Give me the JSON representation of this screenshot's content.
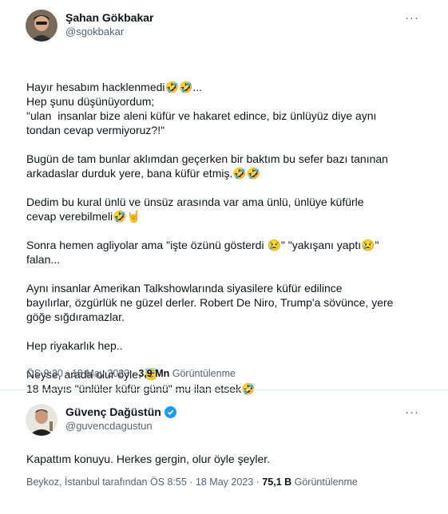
{
  "tweet1": {
    "name": "Şahan Gökbakar",
    "handle": "@sgokbakar",
    "more": "···",
    "lines": [
      "Hayır hesabım hacklenmedi🤣🤣...",
      "Hep şunu düşünüyordum;",
      "\"ulan  insanlar bize aleni küfür ve hakaret edince, biz ünlüyüz diye aynı",
      "tondan cevap vermiyoruz?!\"",
      "",
      "Bugün de tam bunlar aklımdan geçerken bir baktım bu sefer bazı tanınan",
      "arkadaslar durduk yere, bana küfür etmiş.🤣🤣",
      "",
      "Dedim bu kural ünlü ve ünsüz arasında var ama ünlü, ünlüye küfürle",
      "cevap verebilmeli🤣🤘",
      "",
      "Sonra hemen agliyolar ama \"işte özünü gösterdi 😢\" \"yakışanı yaptı😢\"",
      "falan...",
      "",
      "Aynı insanlar Amerikan Talkshowlarında siyasilere küfür edilince",
      "bayılırlar, özgürlük ne güzel derler. Robert De Niro, Trump'a sövünce, yere",
      "göğe sığdıramazlar.",
      "",
      "Hep riyakarlık hep..",
      "",
      "Neyse, arada olur öyle. 😇",
      "18 Mayıs \"ünlüler küfür günü\" mu ilan etsek🤣"
    ],
    "meta_time": "ÖS 9:30 · 18 May 2023 · ",
    "views": "3,9 Mn",
    "views_label": " Görüntülenme"
  },
  "tweet2": {
    "name": "Güvenç Dağüstün",
    "handle": "@guvencdagustun",
    "more": "···",
    "text": "Kapattım konuyu. Herkes gergin, olur öyle şeyler.",
    "meta_time": "Beykoz, İstanbul tarafından ÖS 8:55 · 18 May 2023 · ",
    "views": "75,1 B",
    "views_label": " Görüntülenme"
  },
  "colors": {
    "text": "#0f1419",
    "muted": "#536471",
    "verified": "#1d9bf0"
  }
}
